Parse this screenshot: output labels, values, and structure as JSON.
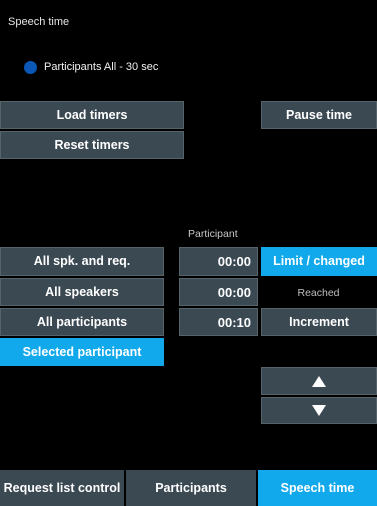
{
  "header": {
    "title": "Speech time"
  },
  "participants_status": {
    "label": "Participants All - 30 sec",
    "dot_color": "#0a57b5"
  },
  "timers": {
    "load_label": "Load timers",
    "reset_label": "Reset timers",
    "pause_label": "Pause time"
  },
  "participant_column": {
    "header": "Participant"
  },
  "left_list": {
    "items": [
      {
        "label": "All spk. and req."
      },
      {
        "label": "All speakers"
      },
      {
        "label": "All participants"
      },
      {
        "label": "Selected participant"
      }
    ]
  },
  "times": {
    "values": [
      "00:00",
      "00:00",
      "00:10"
    ]
  },
  "right_list": {
    "limit_label": "Limit / changed",
    "reached_label": "Reached",
    "increment_label": "Increment",
    "up_icon": "arrow-up-icon",
    "down_icon": "arrow-down-icon"
  },
  "nav": {
    "tabs": [
      {
        "label": "Request list control"
      },
      {
        "label": "Participants"
      },
      {
        "label": "Speech time"
      }
    ]
  },
  "colors": {
    "accent": "#12a9ec",
    "button": "#3b4953",
    "background": "#000000"
  }
}
